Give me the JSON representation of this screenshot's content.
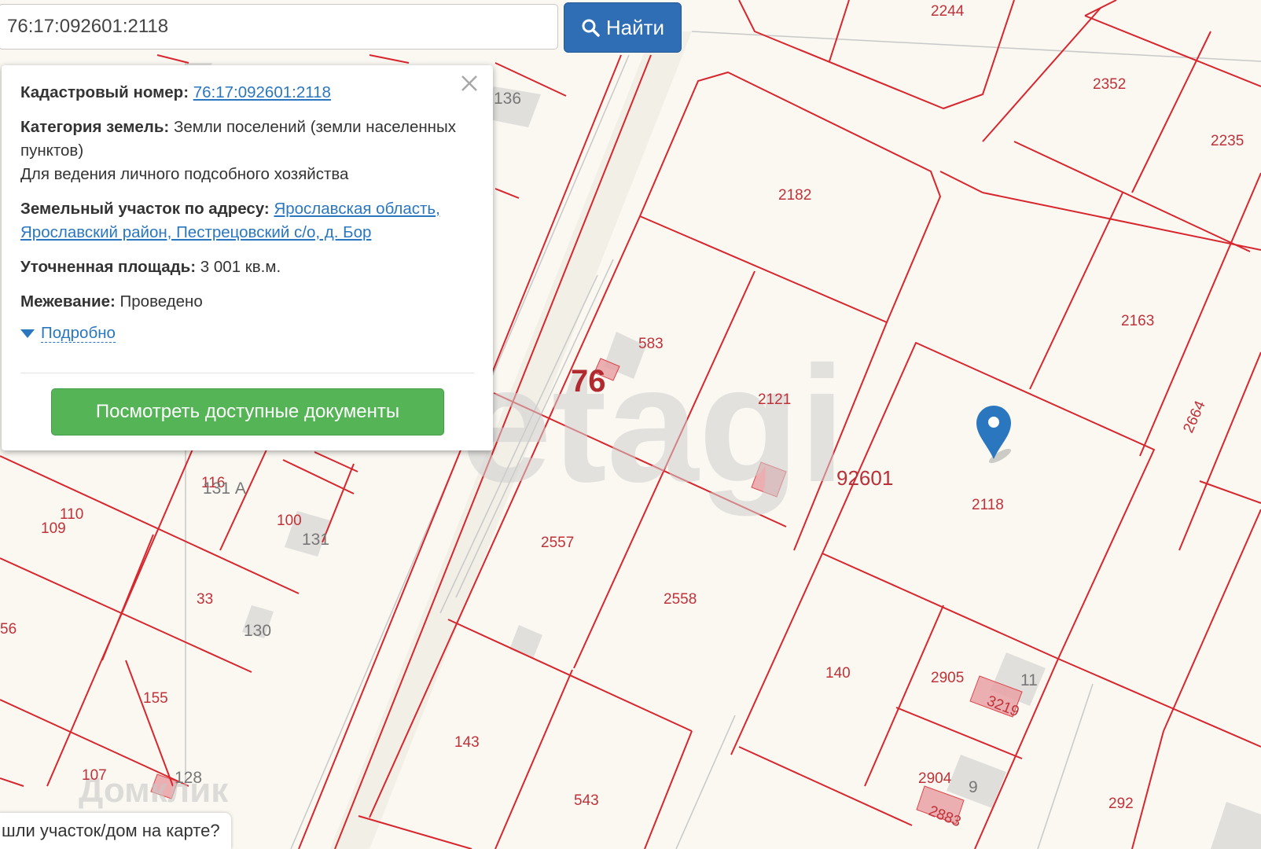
{
  "search": {
    "value": "76:17:092601:2118",
    "button_label": "Найти"
  },
  "popup": {
    "cadastral_label": "Кадастровый номер:",
    "cadastral_value": "76:17:092601:2118",
    "category_label": "Категория земель:",
    "category_value": "Земли поселений (земли населенных пунктов)",
    "use_value": "Для ведения личного подсобного хозяйства",
    "address_label": "Земельный участок по адресу:",
    "address_value": "Ярославская область, Ярославский район, Пестрецовский с/о, д. Бор",
    "area_label": "Уточненная площадь:",
    "area_value": "3 001 кв.м.",
    "survey_label": "Межевание:",
    "survey_value": "Проведено",
    "more_label": "Подробно",
    "docs_button": "Посмотреть доступные документы"
  },
  "bottom_bar": {
    "text": "шли участок/дом на карте?"
  },
  "map": {
    "region_label": "76",
    "quarter_label": "92601",
    "watermark": "etagi",
    "watermark2": "Домклик",
    "plot_labels": {
      "p2244": "2244",
      "p2352": "2352",
      "p2235": "2235",
      "p2182": "2182",
      "p2163": "2163",
      "p583": "583",
      "p2121": "2121",
      "p2664": "2664",
      "p2118": "2118",
      "p2557": "2557",
      "p2558": "2558",
      "p140": "140",
      "p2905": "2905",
      "p3219": "3219",
      "p143": "143",
      "p543": "543",
      "p2904": "2904",
      "p2883": "2883",
      "p292": "292",
      "p110": "110",
      "p109": "109",
      "p116": "116",
      "p100": "100",
      "p33": "33",
      "p56": "56",
      "p155": "155",
      "p107": "107"
    },
    "building_labels": {
      "b136": "136",
      "b131": "131",
      "b130": "130",
      "b11": "11",
      "b9": "9",
      "b128": "128",
      "b131a": "131 А"
    },
    "line_color": "#d8262e",
    "pin_color": "#2a77c0"
  }
}
